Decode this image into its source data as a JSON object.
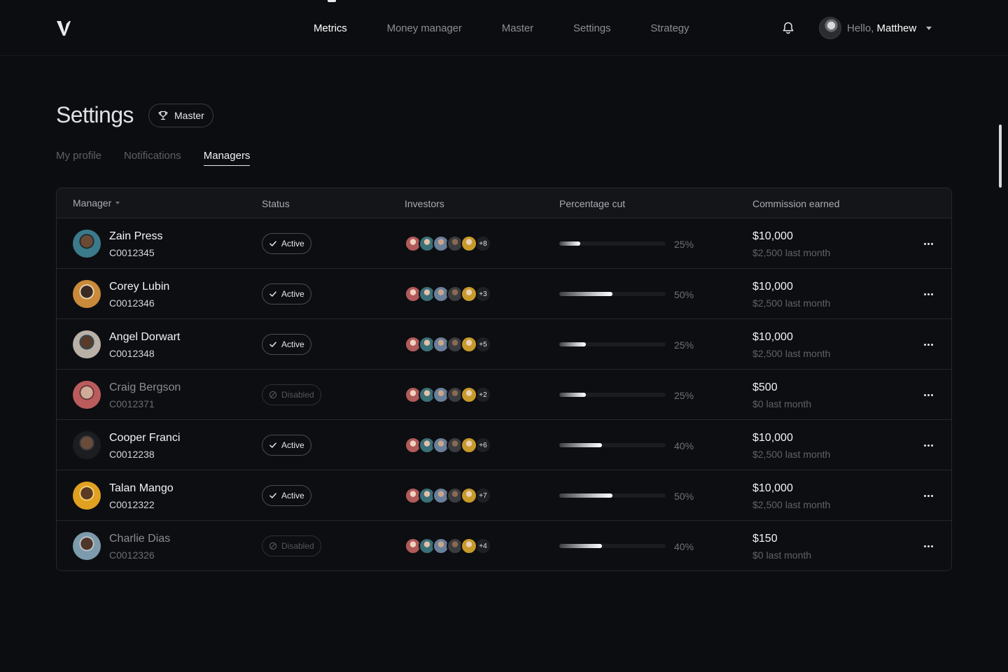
{
  "nav": {
    "items": [
      "Metrics",
      "Money manager",
      "Master",
      "Settings",
      "Strategy"
    ],
    "active": "Metrics"
  },
  "user": {
    "hello": "Hello,",
    "name": "Matthew"
  },
  "page": {
    "title": "Settings",
    "role_chip": "Master"
  },
  "tabs": {
    "items": [
      "My profile",
      "Notifications",
      "Managers"
    ],
    "active": "Managers"
  },
  "table": {
    "headers": {
      "manager": "Manager",
      "status": "Status",
      "investors": "Investors",
      "percentage": "Percentage cut",
      "commission": "Commission earned"
    },
    "rows": [
      {
        "name": "Zain Press",
        "id": "C0012345",
        "status": "Active",
        "more_investors": "+8",
        "pct_value": 0.2,
        "pct": "25%",
        "commission": "$10,000",
        "last": "$2,500 last month"
      },
      {
        "name": "Corey Lubin",
        "id": "C0012346",
        "status": "Active",
        "more_investors": "+3",
        "pct_value": 0.5,
        "pct": "50%",
        "commission": "$10,000",
        "last": "$2,500 last month"
      },
      {
        "name": "Angel Dorwart",
        "id": "C0012348",
        "status": "Active",
        "more_investors": "+5",
        "pct_value": 0.25,
        "pct": "25%",
        "commission": "$10,000",
        "last": "$2,500 last month"
      },
      {
        "name": "Craig Bergson",
        "id": "C0012371",
        "status": "Disabled",
        "more_investors": "+2",
        "pct_value": 0.25,
        "pct": "25%",
        "commission": "$500",
        "last": "$0 last month"
      },
      {
        "name": "Cooper Franci",
        "id": "C0012238",
        "status": "Active",
        "more_investors": "+6",
        "pct_value": 0.4,
        "pct": "40%",
        "commission": "$10,000",
        "last": "$2,500 last month"
      },
      {
        "name": "Talan Mango",
        "id": "C0012322",
        "status": "Active",
        "more_investors": "+7",
        "pct_value": 0.5,
        "pct": "50%",
        "commission": "$10,000",
        "last": "$2,500 last month"
      },
      {
        "name": "Charlie Dias",
        "id": "C0012326",
        "status": "Disabled",
        "more_investors": "+4",
        "pct_value": 0.4,
        "pct": "40%",
        "commission": "$150",
        "last": "$0 last month"
      }
    ]
  },
  "colors": {
    "background": "#0c0d10",
    "text": "#f3f4f6",
    "muted": "#5f6268",
    "border": "#26282d"
  }
}
